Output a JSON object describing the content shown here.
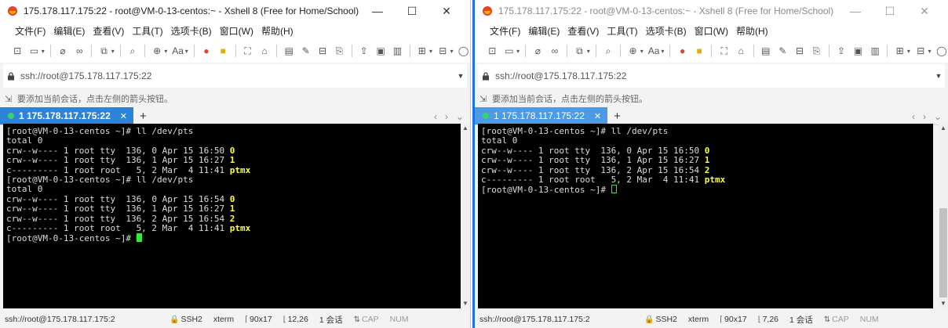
{
  "windows": [
    {
      "title": "175.178.117.175:22 - root@VM-0-13-centos:~ - Xshell 8 (Free for Home/School)",
      "menu": [
        "文件(F)",
        "编辑(E)",
        "查看(V)",
        "工具(T)",
        "选项卡(B)",
        "窗口(W)",
        "帮助(H)"
      ],
      "address": "ssh://root@175.178.117.175:22",
      "hint": "要添加当前会话，点击左侧的箭头按钮。",
      "tab_label": "1 175.178.117.175:22",
      "terminal_lines": [
        {
          "t": "[root@VM-0-13-centos ~]# ll /dev/pts",
          "h": ""
        },
        {
          "t": "total 0",
          "h": ""
        },
        {
          "t": "crw--w---- 1 root tty  136, 0 Apr 15 16:50 ",
          "h": "0"
        },
        {
          "t": "crw--w---- 1 root tty  136, 1 Apr 15 16:27 ",
          "h": "1"
        },
        {
          "t": "c--------- 1 root root   5, 2 Mar  4 11:41 ",
          "h": "ptmx"
        },
        {
          "t": "[root@VM-0-13-centos ~]# ll /dev/pts",
          "h": ""
        },
        {
          "t": "total 0",
          "h": ""
        },
        {
          "t": "crw--w---- 1 root tty  136, 0 Apr 15 16:54 ",
          "h": "0"
        },
        {
          "t": "crw--w---- 1 root tty  136, 1 Apr 15 16:27 ",
          "h": "1"
        },
        {
          "t": "crw--w---- 1 root tty  136, 2 Apr 15 16:54 ",
          "h": "2"
        },
        {
          "t": "c--------- 1 root root   5, 2 Mar  4 11:41 ",
          "h": "ptmx"
        },
        {
          "t": "[root@VM-0-13-centos ~]# ",
          "h": "",
          "cursor": "solid"
        }
      ],
      "status": {
        "path": "ssh://root@175.178.117.175:2",
        "protocol": "SSH2",
        "term": "xterm",
        "size": "90x17",
        "pos": "12,26",
        "sessions": "1 会话",
        "caps": "CAP",
        "num": "NUM"
      }
    },
    {
      "title": "175.178.117.175:22 - root@VM-0-13-centos:~ - Xshell 8 (Free for Home/School)",
      "menu": [
        "文件(F)",
        "编辑(E)",
        "查看(V)",
        "工具(T)",
        "选项卡(B)",
        "窗口(W)",
        "帮助(H)"
      ],
      "address": "ssh://root@175.178.117.175:22",
      "hint": "要添加当前会话，点击左侧的箭头按钮。",
      "tab_label": "1 175.178.117.175:22",
      "terminal_lines": [
        {
          "t": "[root@VM-0-13-centos ~]# ll /dev/pts",
          "h": ""
        },
        {
          "t": "total 0",
          "h": ""
        },
        {
          "t": "crw--w---- 1 root tty  136, 0 Apr 15 16:50 ",
          "h": "0"
        },
        {
          "t": "crw--w---- 1 root tty  136, 1 Apr 15 16:27 ",
          "h": "1"
        },
        {
          "t": "crw--w---- 1 root tty  136, 2 Apr 15 16:54 ",
          "h": "2"
        },
        {
          "t": "c--------- 1 root root   5, 2 Mar  4 11:41 ",
          "h": "ptmx"
        },
        {
          "t": "[root@VM-0-13-centos ~]# ",
          "h": "",
          "cursor": "hollow"
        }
      ],
      "status": {
        "path": "ssh://root@175.178.117.175:2",
        "protocol": "SSH2",
        "term": "xterm",
        "size": "90x17",
        "pos": "7,26",
        "sessions": "1 会话",
        "caps": "CAP",
        "num": "NUM"
      }
    }
  ],
  "icons": {
    "app": "xshell-logo-icon",
    "lock": "lock-icon",
    "hint": "bookmark-add-icon",
    "colors": {
      "tab_active": "#2b83da",
      "tab_inactive": "#4d9be6",
      "session_dot": "#39d36b",
      "cursor": "#39e639",
      "highlight": "#ffff3b"
    }
  }
}
